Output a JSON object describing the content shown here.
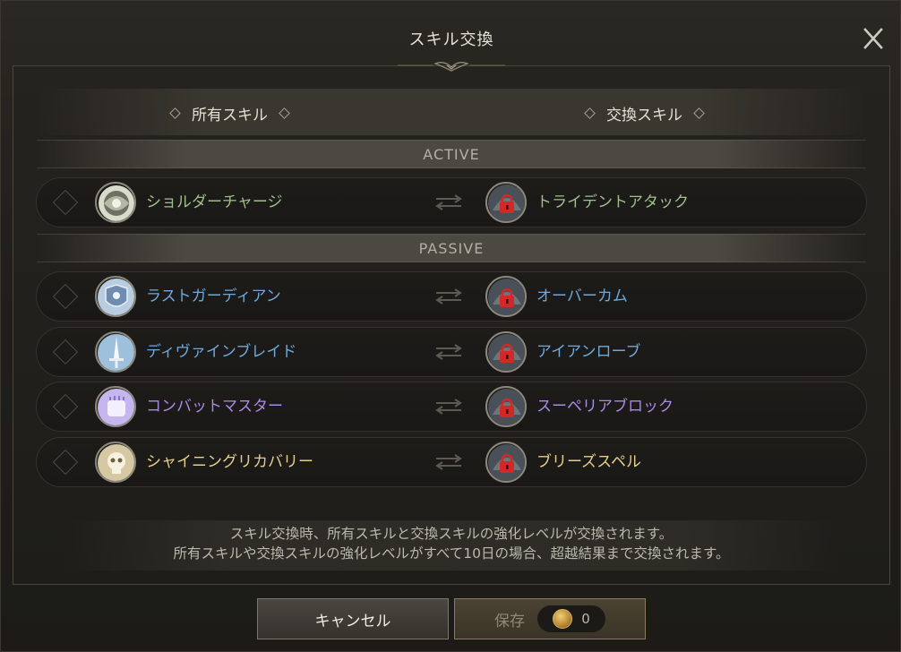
{
  "dialog": {
    "title": "スキル交換",
    "close_label": "X"
  },
  "columns": {
    "owned": "所有スキル",
    "exchange": "交換スキル"
  },
  "sections": {
    "active": "ACTIVE",
    "passive": "PASSIVE"
  },
  "rows": [
    {
      "owned_name": "ショルダーチャージ",
      "exchange_name": "トライデントアタック",
      "color": "#9fc08a",
      "owned_icon": "orb-icon",
      "exchange_icon": "locked-skill-icon",
      "checked": false
    },
    {
      "owned_name": "ラストガーディアン",
      "exchange_name": "オーバーカム",
      "color": "#6fa9dc",
      "owned_icon": "guardian-icon",
      "exchange_icon": "locked-skill-icon",
      "checked": false
    },
    {
      "owned_name": "ディヴァインブレイド",
      "exchange_name": "アイアンローブ",
      "color": "#6fa9dc",
      "owned_icon": "sword-icon",
      "exchange_icon": "locked-skill-icon",
      "checked": false
    },
    {
      "owned_name": "コンバットマスター",
      "exchange_name": "スーペリアブロック",
      "color": "#a98ae6",
      "owned_icon": "fist-icon",
      "exchange_icon": "locked-skill-icon",
      "checked": false
    },
    {
      "owned_name": "シャイニングリカバリー",
      "exchange_name": "ブリーズスペル",
      "color": "#e6cf8c",
      "owned_icon": "skull-icon",
      "exchange_icon": "locked-skill-icon",
      "checked": false
    }
  ],
  "notice": {
    "line1": "スキル交換時、所有スキルと交換スキルの強化レベルが交換されます。",
    "line2": "所有スキルや交換スキルの強化レベルがすべて10日の場合、超越結果まで交換されます。"
  },
  "buttons": {
    "cancel": "キャンセル",
    "save": "保存",
    "cost": "0"
  }
}
